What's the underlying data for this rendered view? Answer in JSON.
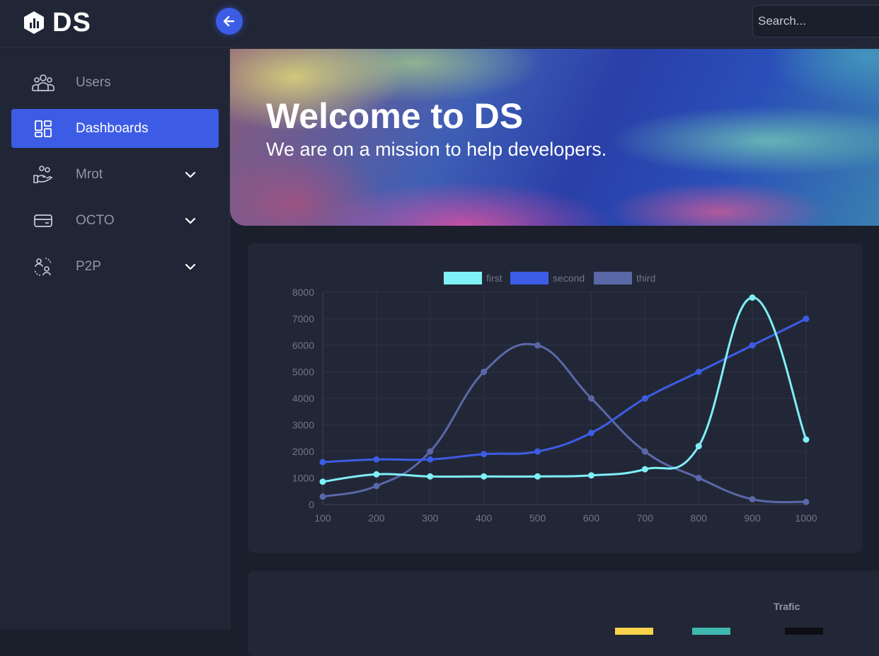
{
  "app": {
    "logo_text": "DS"
  },
  "search": {
    "placeholder": "Search..."
  },
  "sidebar": {
    "items": [
      {
        "label": "Users",
        "icon": "users-icon",
        "active": false,
        "expandable": false
      },
      {
        "label": "Dashboards",
        "icon": "dashboard-icon",
        "active": true,
        "expandable": false
      },
      {
        "label": "Mrot",
        "icon": "hand-coins-icon",
        "active": false,
        "expandable": true
      },
      {
        "label": "OCTO",
        "icon": "card-icon",
        "active": false,
        "expandable": true
      },
      {
        "label": "P2P",
        "icon": "p2p-users-icon",
        "active": false,
        "expandable": true
      }
    ]
  },
  "hero": {
    "title": "Welcome to DS",
    "subtitle": "We are on a mission to help developers."
  },
  "chart_data": {
    "type": "line",
    "x": [
      100,
      200,
      300,
      400,
      500,
      600,
      700,
      800,
      900,
      1000
    ],
    "ylim": [
      0,
      8000
    ],
    "yticks": [
      0,
      1000,
      2000,
      3000,
      4000,
      5000,
      6000,
      7000,
      8000
    ],
    "grid": true,
    "legend_position": "top",
    "series": [
      {
        "name": "first",
        "color": "#7ff0f7",
        "values": [
          860,
          1140,
          1060,
          1060,
          1060,
          1100,
          1330,
          2200,
          7800,
          2450
        ]
      },
      {
        "name": "second",
        "color": "#3d5ce6",
        "values": [
          1600,
          1700,
          1700,
          1900,
          2000,
          2700,
          4000,
          5000,
          6000,
          7000
        ]
      },
      {
        "name": "third",
        "color": "#5a68a8",
        "values": [
          300,
          700,
          2000,
          5000,
          6000,
          4000,
          2000,
          1000,
          200,
          100
        ]
      }
    ]
  },
  "bottom_card": {
    "title": "Trafic",
    "swatch_colors": [
      "#f7d24a",
      "#3fb8b0",
      "#0e0f14"
    ]
  },
  "colors": {
    "accent": "#3d5ce6",
    "background": "#1b1f2c",
    "panel": "#212636"
  }
}
